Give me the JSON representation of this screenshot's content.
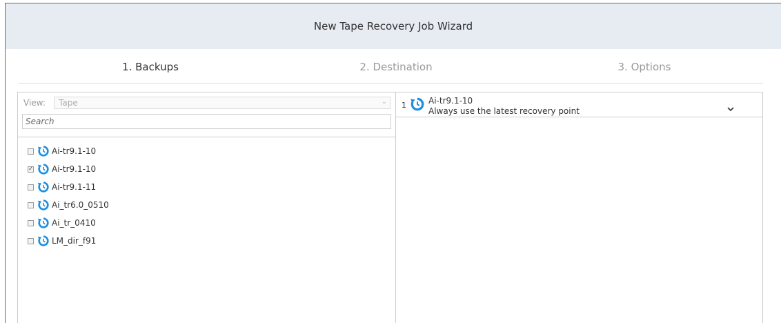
{
  "wizard": {
    "title": "New Tape Recovery Job Wizard",
    "steps": [
      {
        "label": "1. Backups",
        "state": "active"
      },
      {
        "label": "2. Destination",
        "state": "inactive"
      },
      {
        "label": "3. Options",
        "state": "inactive"
      }
    ]
  },
  "left_panel": {
    "view_label": "View:",
    "view_value": "Tape",
    "search_placeholder": "Search",
    "items": [
      {
        "label": "Ai-tr9.1-10",
        "checked": false
      },
      {
        "label": "Ai-tr9.1-10",
        "checked": true
      },
      {
        "label": "Ai-tr9.1-11",
        "checked": false
      },
      {
        "label": "Ai_tr6.0_0510",
        "checked": false
      },
      {
        "label": "Ai_tr_0410",
        "checked": false
      },
      {
        "label": "LM_dir_f91",
        "checked": false
      }
    ]
  },
  "right_panel": {
    "selected": [
      {
        "index": "1",
        "name": "Ai-tr9.1-10",
        "recovery_point": "Always use the latest recovery point"
      }
    ]
  },
  "colors": {
    "accent_icon": "#1e8fe0",
    "header_bg": "#e7ebf2",
    "inactive_step": "#999999"
  },
  "icons": {
    "recovery": "recovery-icon",
    "dropdown": "chevron-down-icon",
    "checkbox": "checkbox-icon"
  }
}
